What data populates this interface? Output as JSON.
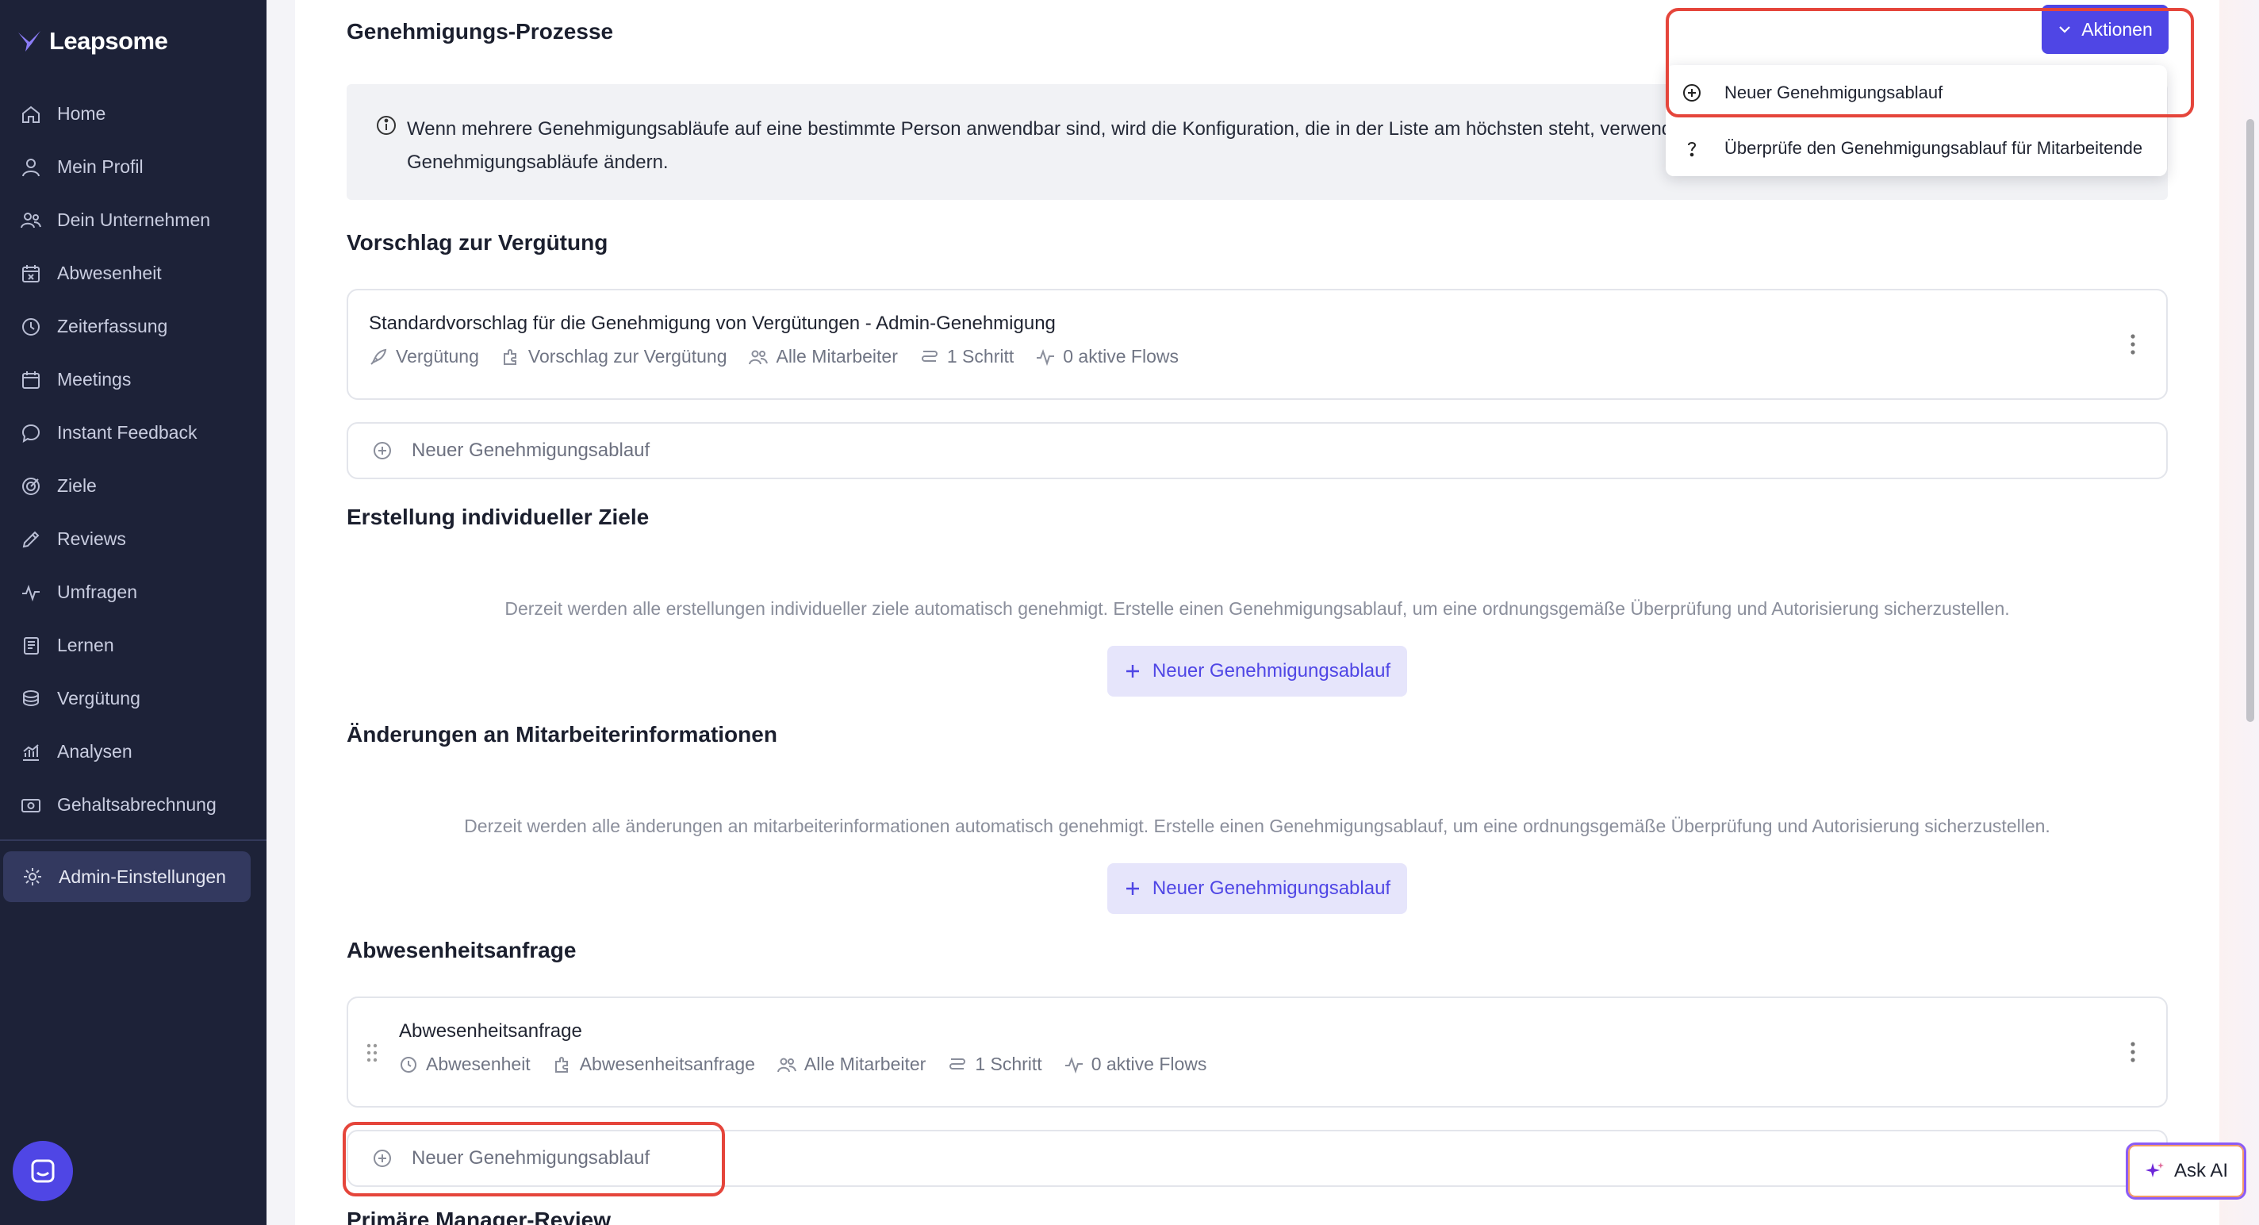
{
  "app": {
    "brand": "Leapsome"
  },
  "sidebar": {
    "items": [
      {
        "label": "Home",
        "icon": "home-icon"
      },
      {
        "label": "Mein Profil",
        "icon": "user-icon"
      },
      {
        "label": "Dein Unternehmen",
        "icon": "users-icon"
      },
      {
        "label": "Abwesenheit",
        "icon": "calendar-x-icon"
      },
      {
        "label": "Zeiterfassung",
        "icon": "clock-icon"
      },
      {
        "label": "Meetings",
        "icon": "calendar-icon"
      },
      {
        "label": "Instant Feedback",
        "icon": "chat-icon"
      },
      {
        "label": "Ziele",
        "icon": "target-icon"
      },
      {
        "label": "Reviews",
        "icon": "pencil-icon"
      },
      {
        "label": "Umfragen",
        "icon": "pulse-icon"
      },
      {
        "label": "Lernen",
        "icon": "book-icon"
      },
      {
        "label": "Vergütung",
        "icon": "coins-icon"
      },
      {
        "label": "Analysen",
        "icon": "chart-icon"
      },
      {
        "label": "Gehaltsabrechnung",
        "icon": "money-icon"
      }
    ],
    "admin": {
      "label": "Admin-Einstellungen",
      "icon": "gear-icon"
    }
  },
  "header": {
    "title": "Genehmigungs-Prozesse",
    "actions_label": "Aktionen"
  },
  "dropdown": {
    "items": [
      {
        "label": "Neuer Genehmigungsablauf",
        "icon": "plus-circle-icon"
      },
      {
        "label": "Überprüfe den Genehmigungsablauf für Mitarbeitende",
        "icon": "question-icon"
      }
    ]
  },
  "info": {
    "text": "Wenn mehrere Genehmigungsabläufe auf eine bestimmte Person anwendbar sind, wird die Konfiguration, die in der Liste am höchsten steht, verwend",
    "text2": "Genehmigungsabläufe ändern."
  },
  "sections": {
    "compensation": {
      "title": "Vorschlag zur Vergütung",
      "card": {
        "name": "Standardvorschlag für die Genehmigung von Vergütungen - Admin-Genehmigung",
        "meta": [
          "Vergütung",
          "Vorschlag zur Vergütung",
          "Alle Mitarbeiter",
          "1 Schritt",
          "0 aktive Flows"
        ]
      },
      "new_flow": "Neuer Genehmigungsablauf"
    },
    "goals": {
      "title": "Erstellung individueller Ziele",
      "empty": "Derzeit werden alle erstellungen individueller ziele automatisch genehmigt. Erstelle einen Genehmigungsablauf, um eine ordnungsgemäße Überprüfung und Autorisierung sicherzustellen.",
      "button": "Neuer Genehmigungsablauf"
    },
    "employee_info": {
      "title": "Änderungen an Mitarbeiterinformationen",
      "empty": "Derzeit werden alle änderungen an mitarbeiterinformationen automatisch genehmigt. Erstelle einen Genehmigungsablauf, um eine ordnungsgemäße Überprüfung und Autorisierung sicherzustellen.",
      "button": "Neuer Genehmigungsablauf"
    },
    "absence": {
      "title": "Abwesenheitsanfrage",
      "card": {
        "name": "Abwesenheitsanfrage",
        "meta": [
          "Abwesenheit",
          "Abwesenheitsanfrage",
          "Alle Mitarbeiter",
          "1 Schritt",
          "0 aktive Flows"
        ]
      },
      "new_flow": "Neuer Genehmigungsablauf"
    },
    "manager_review": {
      "title": "Primäre Manager-Review"
    }
  },
  "ask_ai": {
    "label": "Ask AI"
  },
  "colors": {
    "sidebar_bg": "#1d2238",
    "accent": "#4f46e5",
    "highlight": "#e5453b"
  }
}
